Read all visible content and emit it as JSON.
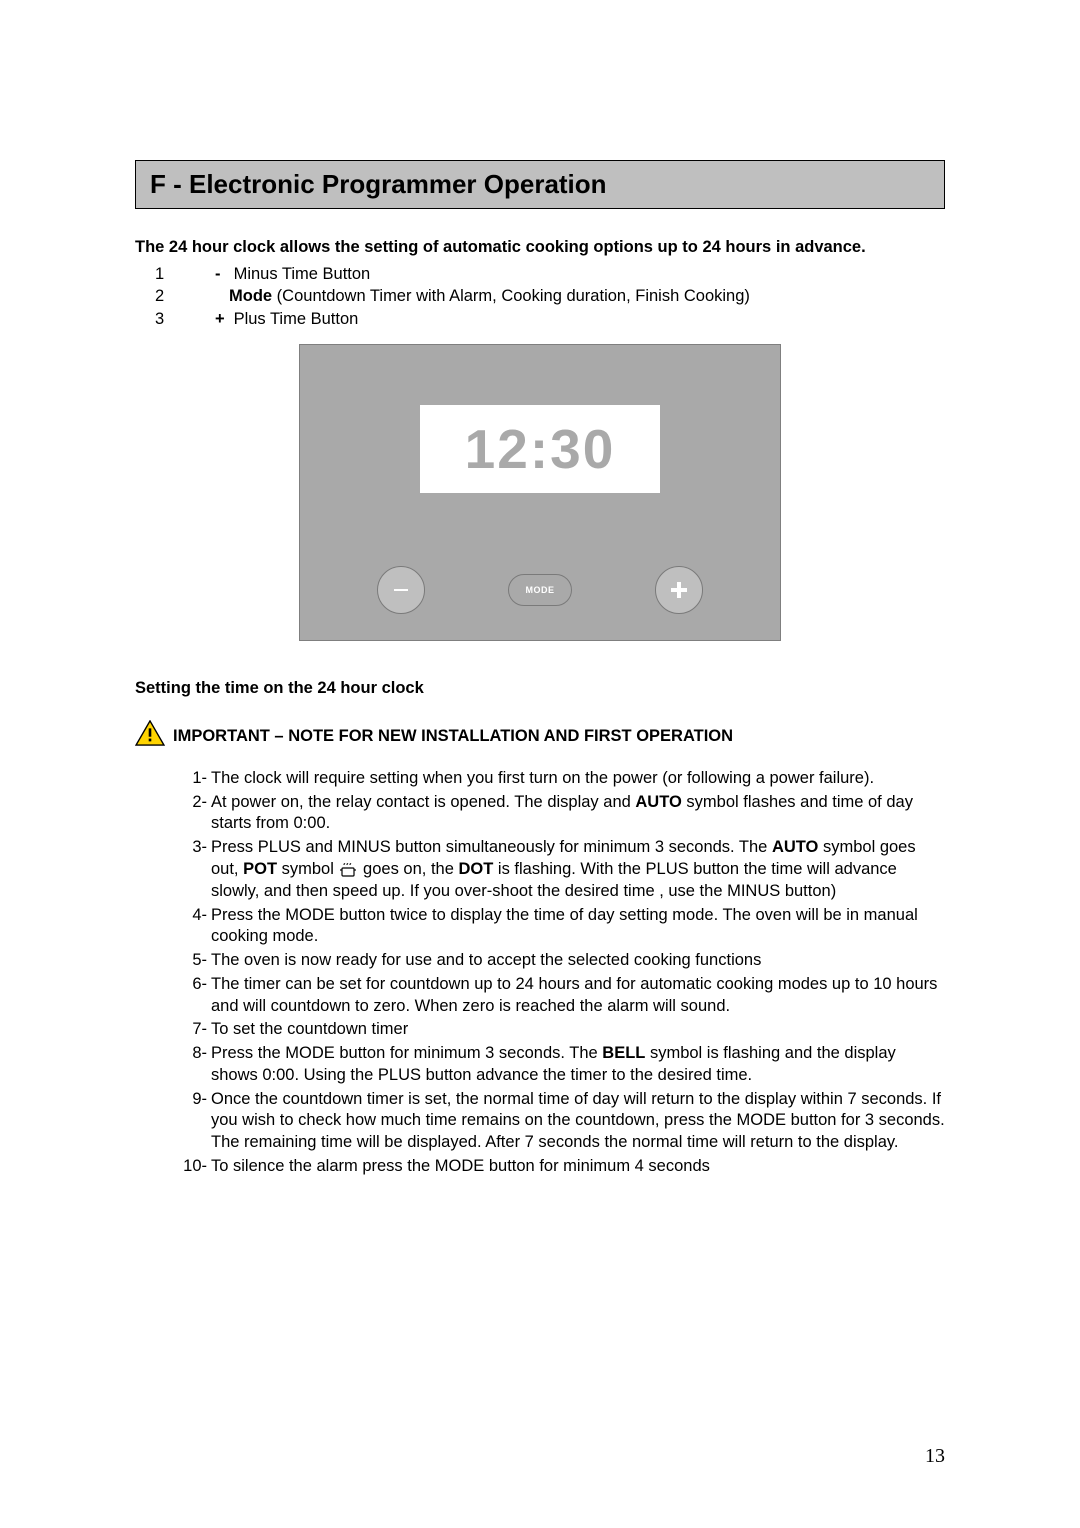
{
  "section_heading": "F -   Electronic Programmer Operation",
  "intro": "The 24 hour clock allows the setting of automatic cooking options up to 24 hours in advance.",
  "legend": [
    {
      "num": "1",
      "sym": "-",
      "text": " Minus Time Button",
      "sym_bold": true
    },
    {
      "num": "2",
      "sym": "",
      "label_bold": "Mode",
      "text": " (Countdown Timer with Alarm, Cooking duration, Finish Cooking)"
    },
    {
      "num": "3",
      "sym": "+",
      "text": " Plus Time Button",
      "sym_bold": true
    }
  ],
  "panel": {
    "display_time": "12:30",
    "mode_label": "MODE"
  },
  "subheading": "Setting the time on the 24 hour clock",
  "important_notice": " IMPORTANT – NOTE FOR NEW INSTALLATION AND FIRST OPERATION",
  "steps": {
    "s1": "The clock will require setting when you first turn on the power (or following a power failure).",
    "s2a": "At power on, the relay contact is opened. The display and ",
    "s2b": "AUTO",
    "s2c": " symbol flashes and time of day starts from 0:00.",
    "s3a": "Press PLUS and MINUS button simultaneously for minimum 3 seconds. The ",
    "s3b": "AUTO",
    "s3c": " symbol goes out, ",
    "s3d": "POT",
    "s3e": " symbol ",
    "s3f": " goes on, the ",
    "s3g": "DOT",
    "s3h": " is flashing. With the PLUS button the time will advance slowly, and then speed up. If you over-shoot the desired time , use the MINUS button)",
    "s4": "Press the MODE button twice to display the time of day setting mode. The oven will be in manual cooking mode.",
    "s5": "The oven is now ready for use and to accept the selected cooking functions",
    "s6": "The timer can be set for countdown up to 24 hours and for automatic cooking modes up to 10 hours and will countdown to zero. When zero is reached the alarm will sound.",
    "s7": "To set the countdown timer",
    "s8a": "Press the MODE button for minimum 3 seconds. The ",
    "s8b": "BELL",
    "s8c": " symbol is flashing and the display shows 0:00. Using the PLUS button advance the timer to the desired time.",
    "s9": "Once the countdown timer is set, the normal time of day will return to the display within 7 seconds. If you wish to check how much time remains on the countdown, press the MODE button for 3 seconds. The remaining time will be displayed. After 7 seconds the normal time will return to the display.",
    "s10": "To silence the alarm press the MODE button for minimum 4 seconds"
  },
  "page_number": "13"
}
